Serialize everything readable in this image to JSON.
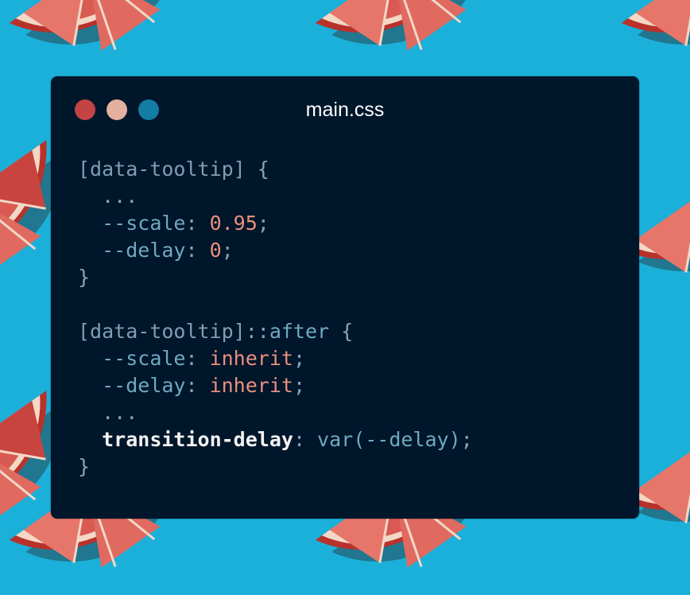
{
  "window": {
    "filename": "main.css",
    "controls": {
      "close_color": "#c24444",
      "minimize_color": "#e4b0a0",
      "maximize_color": "#137da3"
    }
  },
  "code": {
    "line1": {
      "selector": "[data-tooltip]",
      "brace": " {"
    },
    "line2": {
      "text": "..."
    },
    "line3": {
      "prop": "--scale",
      "colon": ": ",
      "value": "0.95",
      "end": ";"
    },
    "line4": {
      "prop": "--delay",
      "colon": ": ",
      "value": "0",
      "end": ";"
    },
    "line5": {
      "text": "}"
    },
    "line7": {
      "selector": "[data-tooltip]",
      "pseudo_sep": "::",
      "pseudo": "after",
      "brace": " {"
    },
    "line8": {
      "prop": "--scale",
      "colon": ": ",
      "value": "inherit",
      "end": ";"
    },
    "line9": {
      "prop": "--delay",
      "colon": ": ",
      "value": "inherit",
      "end": ";"
    },
    "line10": {
      "text": "..."
    },
    "line11": {
      "prop": "transition-delay",
      "colon": ": ",
      "func": "var(--delay)",
      "end": ";"
    },
    "line12": {
      "text": "}"
    }
  },
  "background": {
    "color": "#1bb0d9",
    "pattern": "grapefruit-slices"
  }
}
